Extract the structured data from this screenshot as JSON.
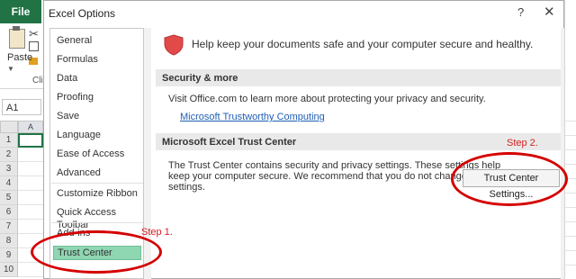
{
  "excel": {
    "file_tab": "File",
    "paste_label": "Paste",
    "clipboard_label": "Cli",
    "name_box": "A1",
    "col_head": "A",
    "rows": [
      "1",
      "2",
      "3",
      "4",
      "5",
      "6",
      "7",
      "8",
      "9",
      "10"
    ]
  },
  "dialog": {
    "title": "Excel Options",
    "help": "?",
    "close": "✕",
    "nav": [
      {
        "label": "General"
      },
      {
        "label": "Formulas"
      },
      {
        "label": "Data"
      },
      {
        "label": "Proofing"
      },
      {
        "label": "Save"
      },
      {
        "label": "Language"
      },
      {
        "label": "Ease of Access"
      },
      {
        "label": "Advanced"
      },
      {
        "label": "Customize Ribbon"
      },
      {
        "label": "Quick Access Toolbar"
      },
      {
        "label": "Add-ins"
      },
      {
        "label": "Trust Center"
      }
    ],
    "banner": "Help keep your documents safe and your computer secure and healthy.",
    "section_security": {
      "title": "Security & more",
      "text": "Visit Office.com to learn more about protecting your privacy and security.",
      "link": "Microsoft Trustworthy Computing"
    },
    "section_trust": {
      "title": "Microsoft Excel Trust Center",
      "line1": "The Trust Center contains security and privacy settings. These settings help",
      "line2": "keep your computer secure. We recommend that you do not change these",
      "line3": "settings.",
      "button": "Trust Center Settings..."
    }
  },
  "annotations": {
    "step1": "Step 1.",
    "step2": "Step 2.",
    "color": "#d50000"
  },
  "colors": {
    "excel_green": "#217346",
    "selected_nav": "#8fd6b2",
    "link": "#1e5fb4",
    "shield": "#e24a4a"
  }
}
